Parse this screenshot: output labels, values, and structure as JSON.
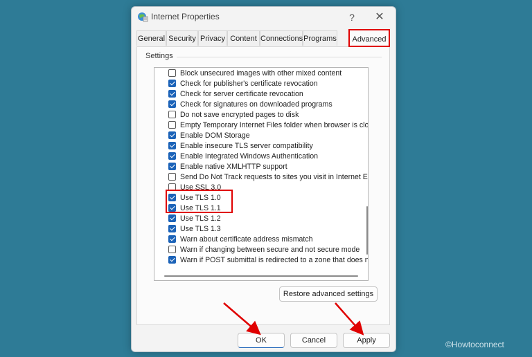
{
  "window": {
    "title": "Internet Properties",
    "help": "?",
    "close": "✕"
  },
  "tabs": [
    {
      "label": "General",
      "active": false
    },
    {
      "label": "Security",
      "active": false
    },
    {
      "label": "Privacy",
      "active": false
    },
    {
      "label": "Content",
      "active": false
    },
    {
      "label": "Connections",
      "active": false
    },
    {
      "label": "Programs",
      "active": false
    },
    {
      "label": "Advanced",
      "active": true
    }
  ],
  "panel": {
    "settings_label": "Settings",
    "items": [
      {
        "label": "Block unsecured images with other mixed content",
        "checked": false
      },
      {
        "label": "Check for publisher's certificate revocation",
        "checked": true
      },
      {
        "label": "Check for server certificate revocation",
        "checked": true
      },
      {
        "label": "Check for signatures on downloaded programs",
        "checked": true
      },
      {
        "label": "Do not save encrypted pages to disk",
        "checked": false
      },
      {
        "label": "Empty Temporary Internet Files folder when browser is clo",
        "checked": false
      },
      {
        "label": "Enable DOM Storage",
        "checked": true
      },
      {
        "label": "Enable insecure TLS server compatibility",
        "checked": true
      },
      {
        "label": "Enable Integrated Windows Authentication",
        "checked": true
      },
      {
        "label": "Enable native XMLHTTP support",
        "checked": true
      },
      {
        "label": "Send Do Not Track requests to sites you visit in Internet E",
        "checked": false
      },
      {
        "label": "Use SSL 3.0",
        "checked": false
      },
      {
        "label": "Use TLS 1.0",
        "checked": true
      },
      {
        "label": "Use TLS 1.1",
        "checked": true
      },
      {
        "label": "Use TLS 1.2",
        "checked": true
      },
      {
        "label": "Use TLS 1.3",
        "checked": true
      },
      {
        "label": "Warn about certificate address mismatch",
        "checked": true
      },
      {
        "label": "Warn if changing between secure and not secure mode",
        "checked": false
      },
      {
        "label": "Warn if POST submittal is redirected to a zone that does n",
        "checked": true
      }
    ],
    "restore_button": "Restore advanced settings"
  },
  "footer": {
    "ok": "OK",
    "cancel": "Cancel",
    "apply": "Apply"
  },
  "watermark": "©Howtoconnect",
  "colors": {
    "background": "#2e7b96",
    "accent": "#1c63b8",
    "annotation": "#e00000"
  }
}
